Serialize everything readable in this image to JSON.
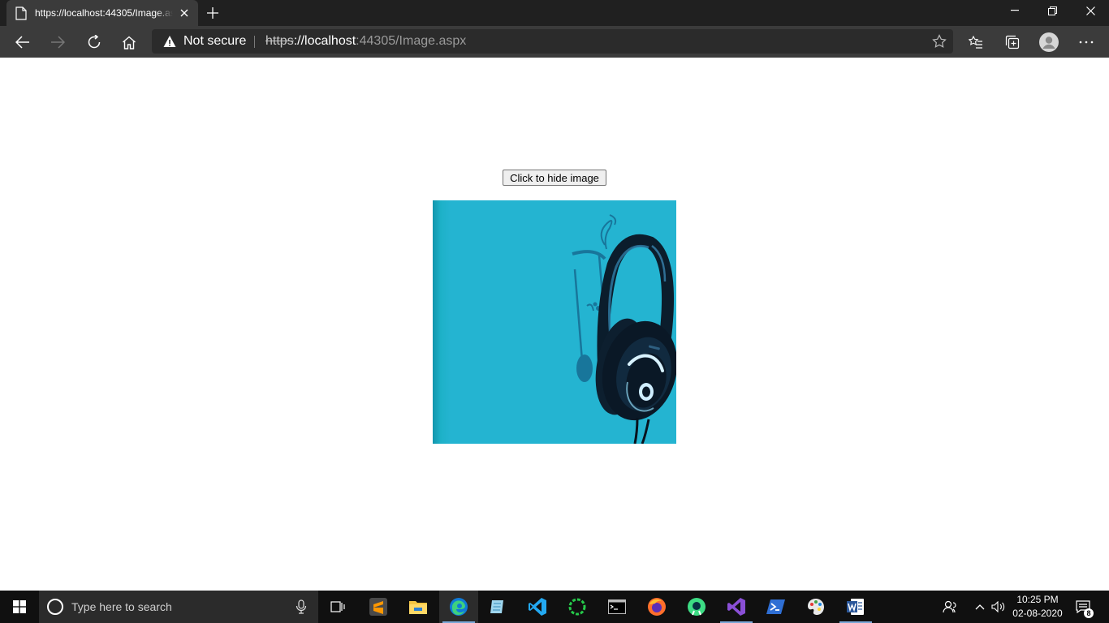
{
  "browser": {
    "tab_title": "https://localhost:44305/Image.aspx",
    "security_label": "Not secure",
    "url": {
      "scheme": "https",
      "host": "://localhost",
      "rest": ":44305/Image.aspx"
    }
  },
  "page": {
    "hide_button_label": "Click to hide image",
    "image": {
      "subject": "headphones with music notes",
      "background_color": "#24b4d1"
    }
  },
  "taskbar": {
    "search_placeholder": "Type here to search",
    "clock_time": "10:25 PM",
    "clock_date": "02-08-2020",
    "notification_count": "8",
    "pinned_icons": [
      "mic-icon",
      "task-view-icon",
      "sublime-text-icon",
      "file-explorer-icon",
      "edge-browser-icon",
      "notepad-icon",
      "vscode-icon",
      "app-green-icon",
      "command-prompt-icon",
      "firefox-icon",
      "android-studio-icon",
      "visual-studio-icon",
      "powershell-icon",
      "paint-icon",
      "word-icon"
    ]
  },
  "colors": {
    "tabstrip": "#202020",
    "toolbar": "#3b3b3b",
    "taskbar": "#101010",
    "image_bg": "#24b4d1"
  }
}
